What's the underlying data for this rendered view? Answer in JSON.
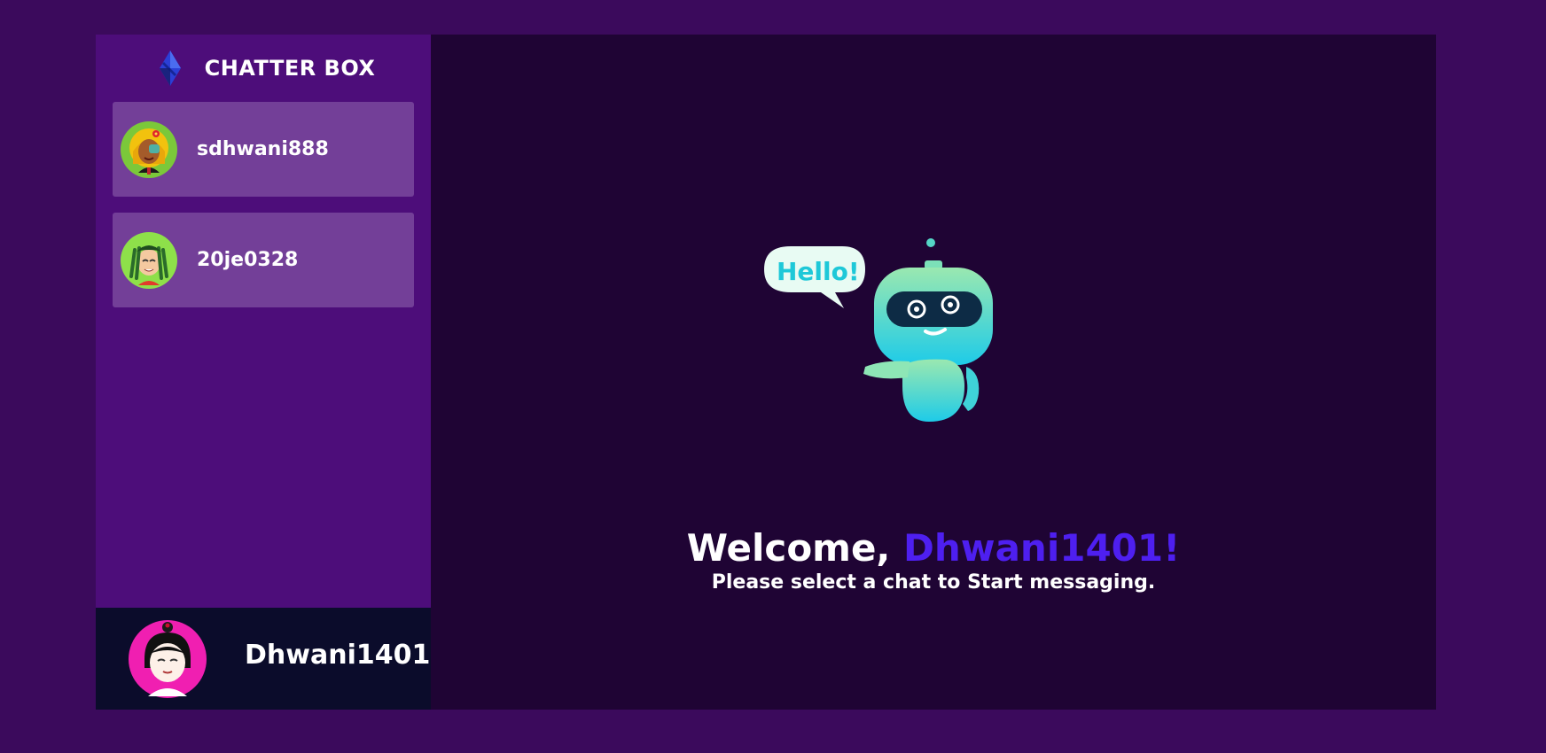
{
  "brand": {
    "name": "CHATTER BOX",
    "logo_icon": "diamond-logo-icon"
  },
  "contacts": [
    {
      "username": "sdhwani888",
      "avatar_icon": "avatar-girl-flower-icon"
    },
    {
      "username": "20je0328",
      "avatar_icon": "avatar-girl-dreadlocks-icon"
    }
  ],
  "current_user": {
    "username": "Dhwani1401",
    "avatar_icon": "avatar-girl-bun-icon"
  },
  "welcome": {
    "greeting": "Welcome, ",
    "username": "Dhwani1401!",
    "subtitle": "Please select a chat to Start messaging.",
    "speech_bubble": "Hello!"
  },
  "colors": {
    "page_bg": "#3b0a5c",
    "sidebar_bg": "#4d0d7a",
    "contact_bg": "#733f98",
    "main_bg": "#1f0434",
    "footer_bg": "#0b0c2b",
    "accent": "#4e1ff0"
  }
}
